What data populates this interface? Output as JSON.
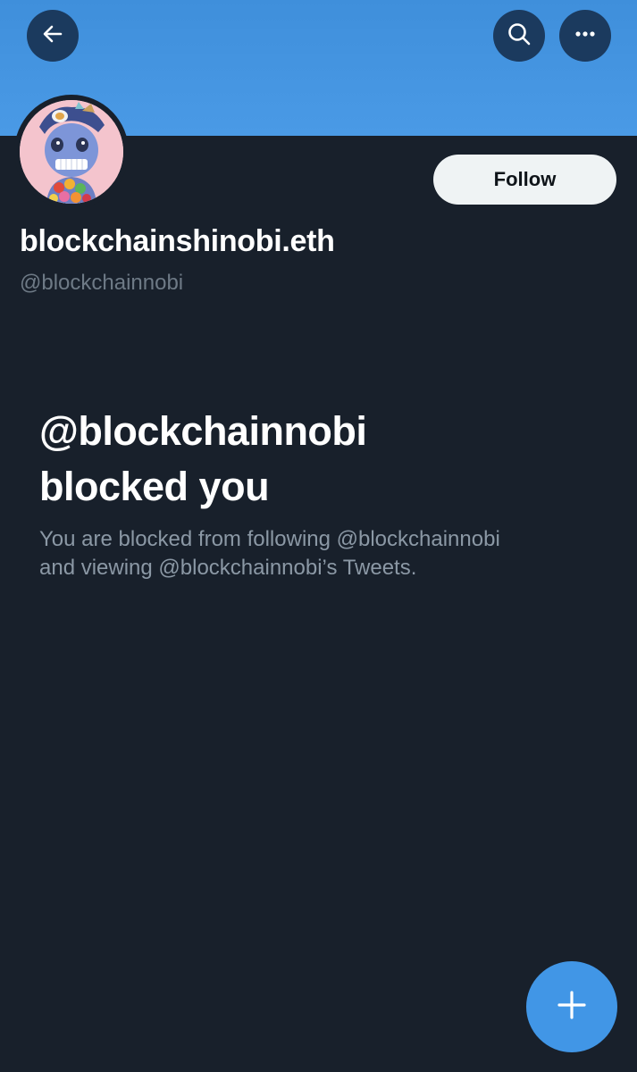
{
  "profile": {
    "display_name": "blockchainshinobi.eth",
    "handle": "@blockchainnobi",
    "follow_label": "Follow"
  },
  "icons": {
    "back": "arrow-left-icon",
    "search": "search-icon",
    "more": "more-horizontal-icon",
    "compose": "plus-icon"
  },
  "blocked": {
    "title_line1": "@blockchainnobi",
    "title_line2": "blocked you",
    "desc_line1": "You are blocked from following @blockchainnobi",
    "desc_line2": "and viewing @blockchainnobi’s Tweets."
  },
  "colors": {
    "banner": "#4a9ae6",
    "background": "#18202b",
    "accent": "#4196e6",
    "follow_bg": "#eff3f4"
  }
}
